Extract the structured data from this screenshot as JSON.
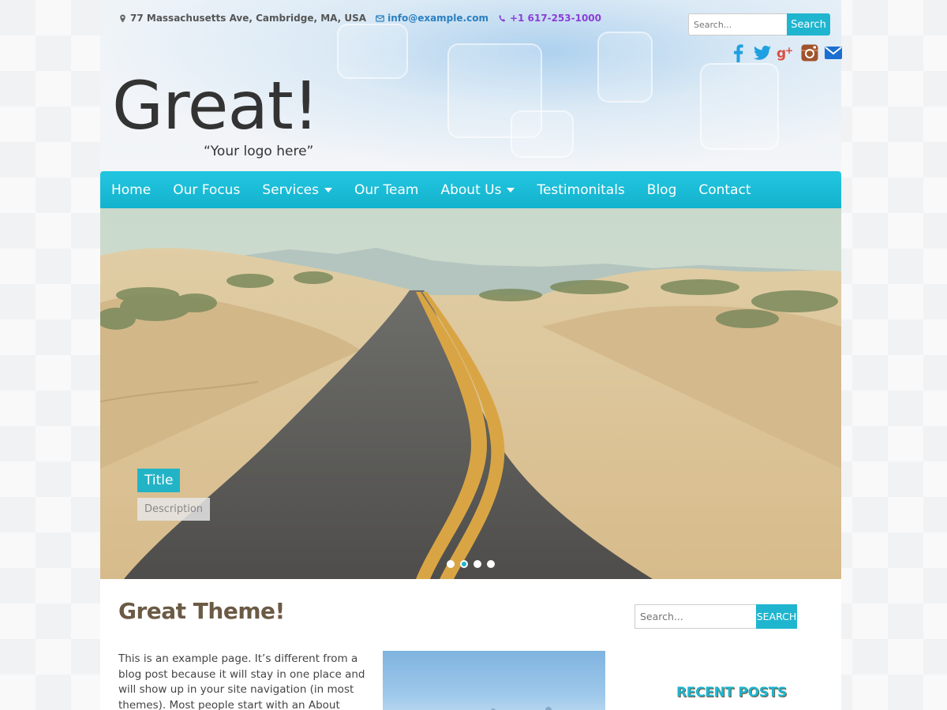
{
  "contact": {
    "address": "77 Massachusetts Ave, Cambridge, MA, USA",
    "email": "info@example.com",
    "phone": "+1 617-253-1000"
  },
  "top_search": {
    "placeholder": "Search...",
    "button": "Search"
  },
  "socials": [
    "facebook-icon",
    "twitter-icon",
    "google-plus-icon",
    "instagram-icon",
    "email-icon"
  ],
  "logo": {
    "title": "Great!",
    "tagline": "“Your logo here”"
  },
  "nav": [
    {
      "label": "Home"
    },
    {
      "label": "Our Focus"
    },
    {
      "label": "Services",
      "dropdown": true
    },
    {
      "label": "Our Team"
    },
    {
      "label": "About Us",
      "dropdown": true
    },
    {
      "label": "Testimonitals"
    },
    {
      "label": "Blog"
    },
    {
      "label": "Contact"
    }
  ],
  "slider": {
    "title": "Title",
    "description": "Description",
    "slide_count": 4,
    "active_slide": 2
  },
  "page": {
    "title": "Great Theme!",
    "body": "This is an example page. It’s different from a blog post because it will stay in one place and will show up in your site navigation (in most themes). Most people start with an About page that introduces"
  },
  "sidebar": {
    "search": {
      "placeholder": "Search...",
      "button": "SEARCH"
    },
    "recent_posts_title": "RECENT POSTS"
  },
  "colors": {
    "accent": "#1fb5cf",
    "title_brown": "#6b5a45",
    "email": "#2a7fc0",
    "phone": "#8a3fd6"
  }
}
